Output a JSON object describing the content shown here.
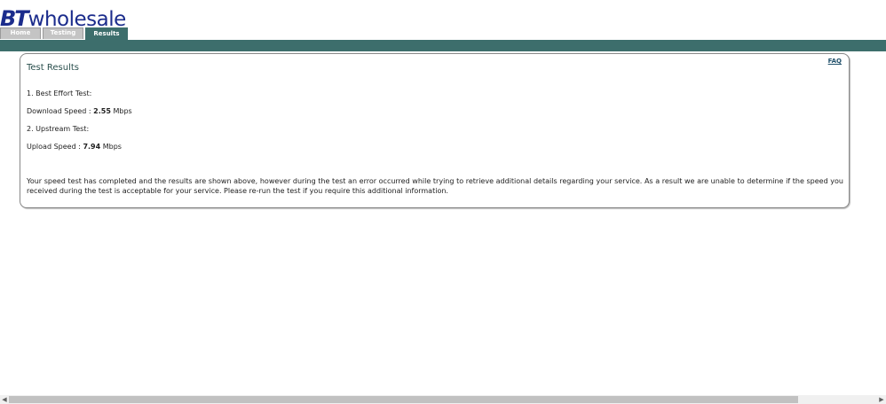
{
  "logo": {
    "bt": "BT",
    "wholesale": "wholesale"
  },
  "tabs": [
    {
      "label": "Home",
      "active": false
    },
    {
      "label": "Testing",
      "active": false
    },
    {
      "label": "Results",
      "active": true
    }
  ],
  "results": {
    "title": "Test Results",
    "faq_label": "FAQ",
    "best_effort_heading": "1. Best Effort Test:",
    "download_label": "Download Speed : ",
    "download_value": "2.55",
    "download_unit": " Mbps",
    "upstream_heading": "2. Upstream Test:",
    "upload_label": "Upload Speed : ",
    "upload_value": "7.94",
    "upload_unit": " Mbps",
    "message": "Your speed test has completed and the results are shown above, however during the test an error occurred while trying to retrieve additional details regarding your service. As a result we are unable to determine if the speed you received during the test is acceptable for your service. Please re-run the test if you require this additional information."
  },
  "scrollbar": {
    "left_icon": "chevron-left-icon",
    "right_icon": "chevron-right-icon"
  },
  "colors": {
    "brand_blue": "#1b2c8c",
    "teal": "#3d6e6c",
    "tab_inactive": "#c4c4c4"
  }
}
